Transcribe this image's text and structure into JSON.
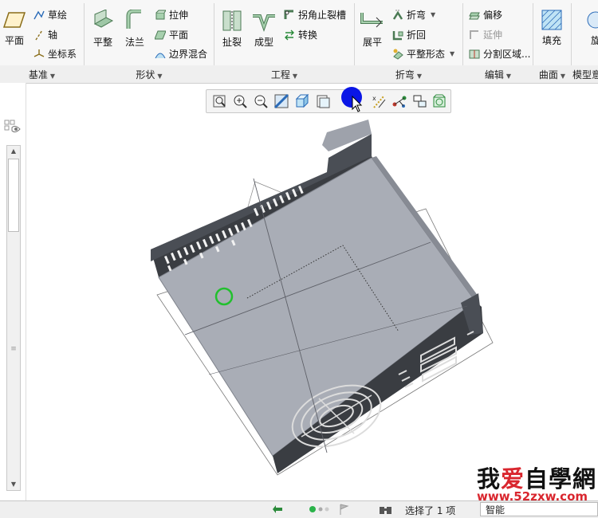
{
  "ribbon": {
    "datum": {
      "plane": "平面",
      "sketch": "草绘",
      "axis": "轴",
      "csys": "坐标系",
      "group": "基准"
    },
    "shapes": {
      "flat": "平整",
      "flange": "法兰",
      "extrude": "拉伸",
      "planar": "平面",
      "boundary_blend": "边界混合",
      "group": "形状"
    },
    "engineering": {
      "rip": "扯裂",
      "form": "成型",
      "corner_relief": "拐角止裂槽",
      "convert": "转换",
      "group": "工程"
    },
    "bends": {
      "unbend": "展平",
      "bend": "折弯",
      "bend_back": "折回",
      "flat_state": "平整形态",
      "group": "折弯"
    },
    "editing": {
      "offset": "偏移",
      "extend": "延伸",
      "split_area": "分割区域...",
      "group": "编辑"
    },
    "surfaces": {
      "fill": "填充",
      "group": "曲面"
    },
    "model": {
      "rotate": "旋",
      "group": "模型意"
    }
  },
  "view_toolbar": {
    "icons": [
      "refit-icon",
      "zoom-in-icon",
      "zoom-out-icon",
      "repaint-icon",
      "display-style-icon",
      "saved-views-icon",
      "view-manager-icon",
      "datum-display-icon",
      "spin-center-icon",
      "annotation-icon",
      "appearance-icon"
    ]
  },
  "status": {
    "selected": "选择了 1 项",
    "filter": "智能"
  },
  "watermark": {
    "brand": "我爱自學網",
    "heart_char": "爱",
    "url": "www.52zxw.com"
  },
  "colors": {
    "cursor_blue": "#0a16e6",
    "part_gray": "#a9adb6",
    "part_dark": "#3a3d42"
  }
}
